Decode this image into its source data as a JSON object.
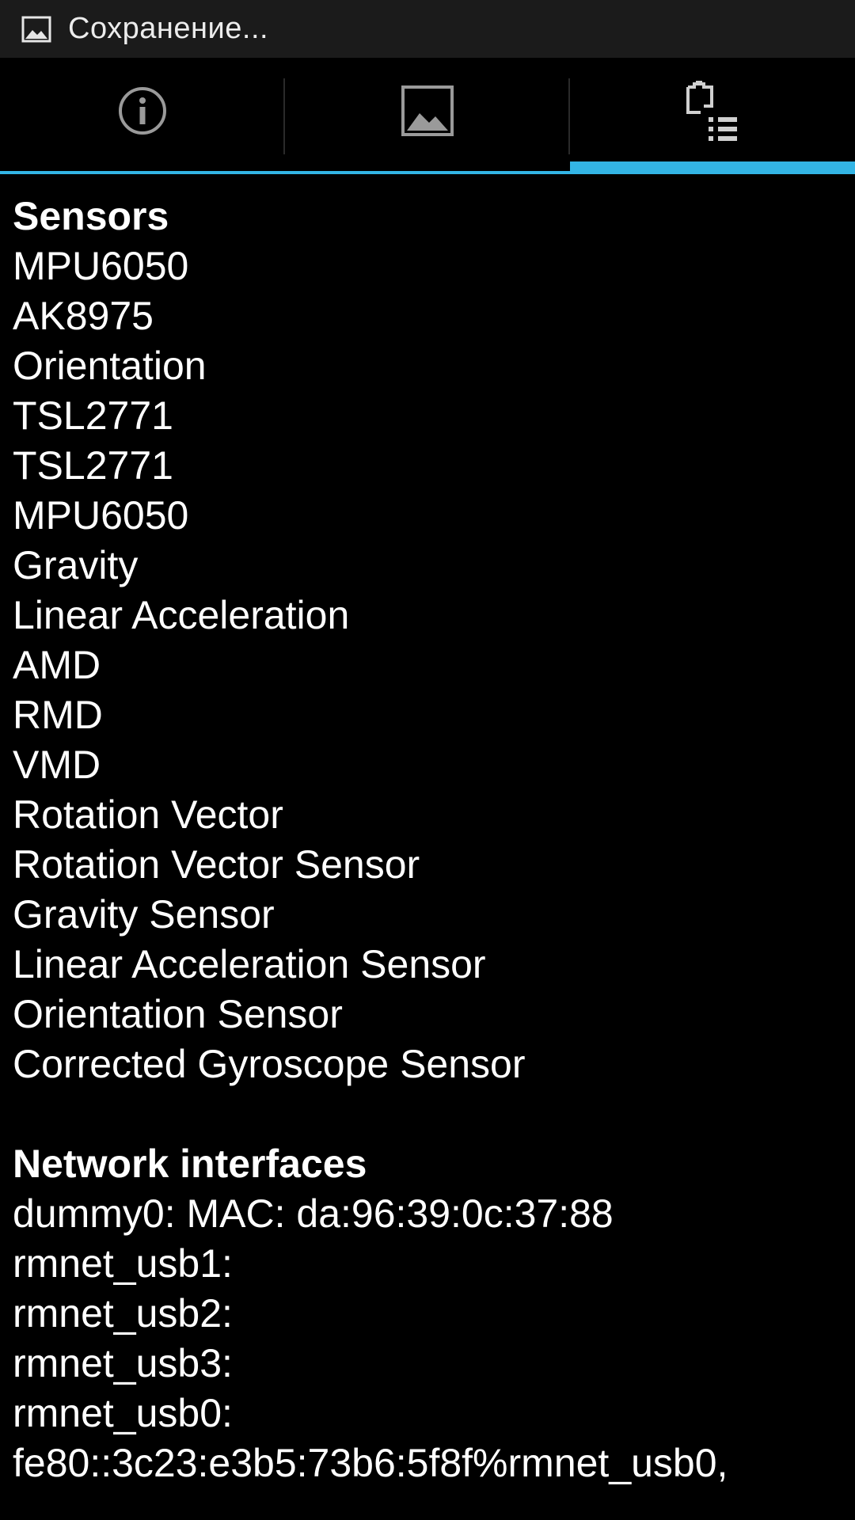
{
  "status_bar": {
    "icon": "image-icon",
    "text": "Сохранение..."
  },
  "tabs": [
    {
      "icon": "info-icon",
      "selected": false
    },
    {
      "icon": "image-icon",
      "selected": false
    },
    {
      "icon": "device-list-icon",
      "selected": true
    }
  ],
  "accent_color": "#33b5e5",
  "sensors": {
    "title": "Sensors",
    "items": [
      "MPU6050",
      "AK8975",
      "Orientation",
      "TSL2771",
      "TSL2771",
      "MPU6050",
      "Gravity",
      "Linear Acceleration",
      "AMD",
      "RMD",
      "VMD",
      "Rotation Vector",
      "Rotation Vector Sensor",
      "Gravity Sensor",
      "Linear Acceleration Sensor",
      "Orientation Sensor",
      "Corrected Gyroscope Sensor"
    ]
  },
  "network": {
    "title": "Network interfaces",
    "items": [
      "dummy0: MAC: da:96:39:0c:37:88",
      "rmnet_usb1:",
      "rmnet_usb2:",
      "rmnet_usb3:",
      "rmnet_usb0:",
      "fe80::3c23:e3b5:73b6:5f8f%rmnet_usb0,"
    ]
  }
}
